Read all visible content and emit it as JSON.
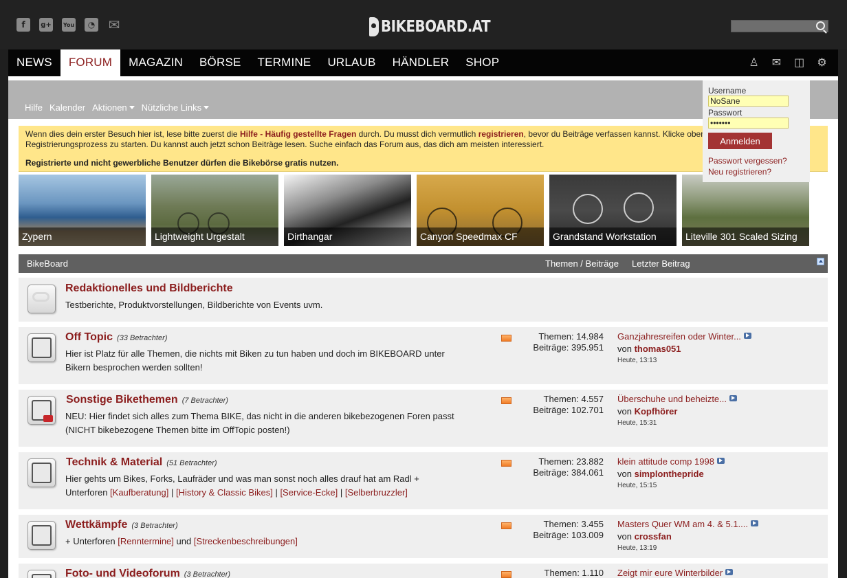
{
  "header": {
    "social_icons": [
      "facebook-icon",
      "google-plus-icon",
      "youtube-icon",
      "rss-icon",
      "mail-icon"
    ],
    "social_glyphs": [
      "f",
      "g+",
      "You",
      "◔",
      "✉"
    ],
    "logo_text": "BIKEBOARD.AT",
    "search_placeholder": ""
  },
  "mainnav": {
    "items": [
      "NEWS",
      "FORUM",
      "MAGAZIN",
      "BÖRSE",
      "TERMINE",
      "URLAUB",
      "HÄNDLER",
      "SHOP"
    ],
    "active": "FORUM",
    "icons": [
      "user-icon",
      "mail-icon",
      "cart-icon",
      "settings-icon"
    ]
  },
  "subnav": {
    "items": [
      "Hilfe",
      "Kalender",
      "Aktionen",
      "Nützliche Links"
    ]
  },
  "notice": {
    "part1": "Wenn dies dein erster Besuch hier ist, lese bitte zuerst die ",
    "link1": "Hilfe - Häufig gestellte Fragen",
    "part2": " durch. Du musst dich vermutlich ",
    "link2": "registrieren",
    "part3": ", bevor du Beiträge verfassen kannst. Klicke oben auf Registrieren, um den Registrierungsprozess zu starten. Du kannst auch jetzt schon Beiträge lesen. Suche einfach das Forum aus, das dich am meisten interessiert.",
    "bold": "Registrierte und nicht gewerbliche Benutzer dürfen die Bikebörse gratis nutzen."
  },
  "login": {
    "username_label": "Username",
    "username_value": "NoSane",
    "password_label": "Passwort",
    "password_value": "•••••••",
    "button": "Anmelden",
    "forgot": "Passwort vergessen?",
    "register": "Neu registrieren?"
  },
  "slider": {
    "items": [
      "Zypern",
      "Lightweight Urgestalt",
      "Dirthangar",
      "Canyon Speedmax CF",
      "Grandstand Workstation",
      "Liteville 301 Scaled Sizing"
    ]
  },
  "forum_header": {
    "title": "BikeBoard",
    "col_stats": "Themen / Beiträge",
    "col_last": "Letzter Beitrag"
  },
  "forums": [
    {
      "name": "Redaktionelles und Bildberichte",
      "viewers": "",
      "desc": "Testberichte, Produktvorstellungen, Bildberichte von Events uvm."
    },
    {
      "name": "Off Topic",
      "viewers": "(33 Betrachter)",
      "desc": "Hier ist Platz für alle Themen, die nichts mit Biken zu tun haben und doch im BIKEBOARD unter Bikern besprochen werden sollten!",
      "themen": "Themen: 14.984",
      "beitraege": "Beiträge: 395.951",
      "last_title": "Ganzjahresreifen oder Winter...",
      "last_by": "von",
      "last_user": "thomas051",
      "last_time": "Heute, 13:13"
    },
    {
      "name": "Sonstige Bikethemen",
      "viewers": "(7 Betrachter)",
      "desc": "NEU: Hier findet sich alles zum Thema BIKE, das nicht in die anderen bikebezogenen Foren passt (NICHT bikebezogene Themen bitte im OffTopic posten!)",
      "themen": "Themen: 4.557",
      "beitraege": "Beiträge: 102.701",
      "last_title": "Überschuhe und beheizte...",
      "last_by": "von",
      "last_user": "Kopfhörer",
      "last_time": "Heute, 15:31"
    },
    {
      "name": "Technik & Material",
      "viewers": "(51 Betrachter)",
      "desc_prefix": "Hier gehts um Bikes, Forks, Laufräder und was man sonst noch alles drauf hat am Radl + Unterforen ",
      "subforums": [
        "[Kaufberatung]",
        "[History & Classic Bikes]",
        "[Service-Ecke]",
        "[Selberbruzzler]"
      ],
      "sep": " | ",
      "themen": "Themen: 23.882",
      "beitraege": "Beiträge: 384.061",
      "last_title": "klein attitude comp 1998",
      "last_by": "von",
      "last_user": "simplonthepride",
      "last_time": "Heute, 15:15"
    },
    {
      "name": "Wettkämpfe",
      "viewers": "(3 Betrachter)",
      "desc_prefix": "+ Unterforen ",
      "subforums": [
        "[Renntermine]",
        "[Streckenbeschreibungen]"
      ],
      "joiner": " und ",
      "themen": "Themen: 3.455",
      "beitraege": "Beiträge: 103.009",
      "last_title": "Masters Quer WM am 4. & 5.1....",
      "last_by": "von",
      "last_user": "crossfan",
      "last_time": "Heute, 13:19"
    },
    {
      "name": "Foto- und Videoforum",
      "viewers": "(3 Betrachter)",
      "themen": "Themen: 1.110",
      "last_title": "Zeigt mir eure Winterbilder"
    }
  ]
}
